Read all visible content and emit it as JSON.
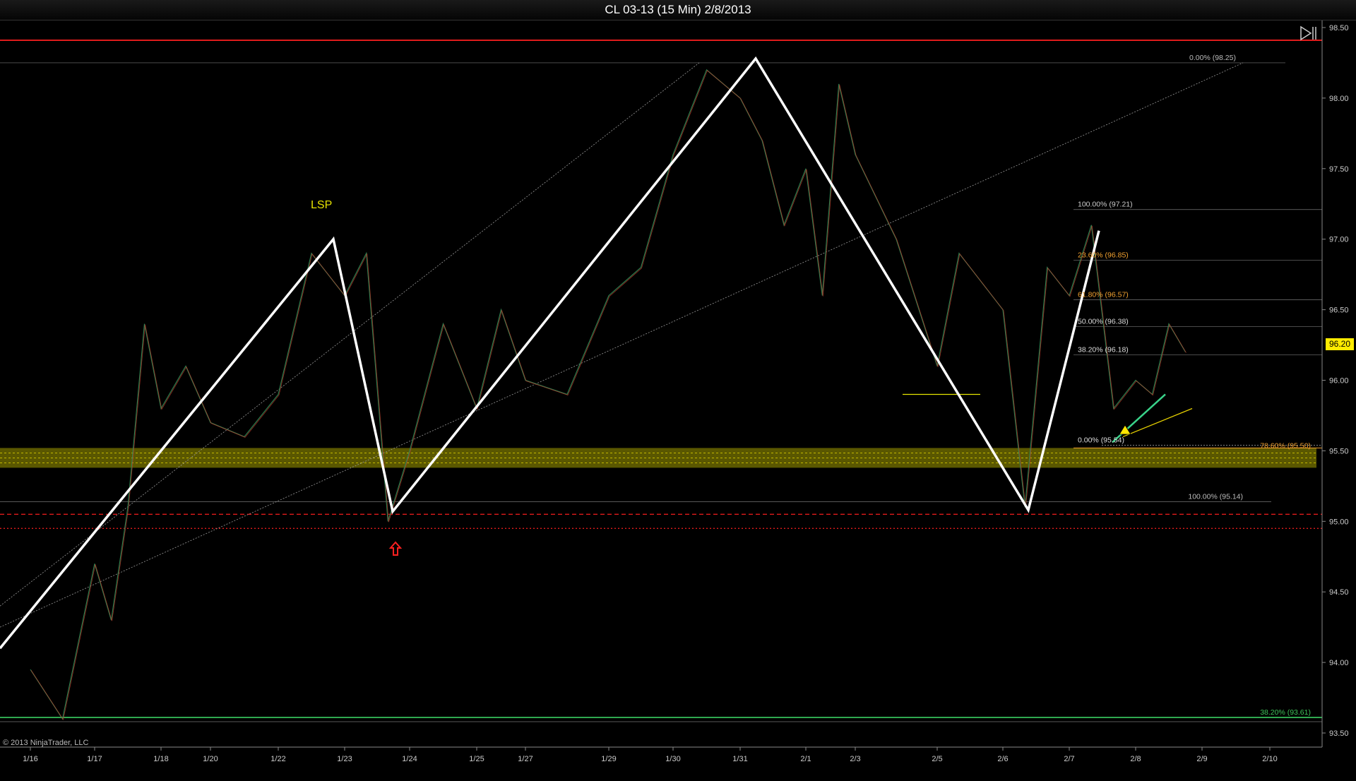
{
  "window": {
    "title": "CL 03-13 (15 Min)  2/8/2013"
  },
  "footer": {
    "copyright": "© 2013 NinjaTrader, LLC"
  },
  "last_price": "96.20",
  "icons": {
    "scroll": "scroll-end-icon",
    "marker": "red-up-arrow-icon",
    "alert": "warning-triangle-icon"
  },
  "colors": {
    "background": "#000000",
    "zigzag": "#ffffff",
    "resistance": "#e01b1b",
    "zone": "#c8c000",
    "fib_orange": "#f0a030",
    "green": "#39d38a",
    "price_badge": "#ffeb00"
  },
  "chart_data": {
    "type": "line",
    "title": "CL 03-13 (15 Min)  2/8/2013",
    "ylim": [
      93.4,
      98.55
    ],
    "y_ticks": [
      "98.50",
      "98.00",
      "97.50",
      "97.00",
      "96.50",
      "96.00",
      "95.50",
      "95.00",
      "94.50",
      "94.00",
      "93.50"
    ],
    "x_ticks": [
      "1/16",
      "1/17",
      "1/18",
      "1/20",
      "1/22",
      "1/23",
      "1/24",
      "1/25",
      "1/27",
      "1/29",
      "1/30",
      "1/31",
      "2/1",
      "2/3",
      "2/5",
      "2/6",
      "2/7",
      "2/8",
      "2/9",
      "2/10"
    ],
    "annotations": {
      "lsp": "LSP"
    },
    "zigzag": [
      {
        "date": "1/16",
        "price": 94.1
      },
      {
        "date": "1/22",
        "price": 97.0
      },
      {
        "date": "1/23",
        "price": 95.07
      },
      {
        "date": "1/31",
        "price": 98.28
      },
      {
        "date": "2/6",
        "price": 95.08
      },
      {
        "date": "2/7",
        "price": 97.06
      }
    ],
    "horizontal_levels": [
      {
        "price": 98.41,
        "color": "red",
        "style": "solid"
      },
      {
        "price": 95.05,
        "color": "red",
        "style": "dashed"
      },
      {
        "price": 94.95,
        "color": "red",
        "style": "dotted"
      },
      {
        "price": 93.61,
        "color": "green",
        "style": "solid"
      }
    ],
    "support_zone": {
      "low": 95.38,
      "high": 95.52
    },
    "fib_labels": [
      {
        "text": "0.00% (98.25)",
        "price": 98.25
      },
      {
        "text": "100.00% (97.21)",
        "price": 97.21
      },
      {
        "text": "23.60% (96.85)",
        "price": 96.85
      },
      {
        "text": "61.80% (96.57)",
        "price": 96.57
      },
      {
        "text": "50.00% (96.38)",
        "price": 96.38
      },
      {
        "text": "38.20% (96.18)",
        "price": 96.18
      },
      {
        "text": "0.00% (95.54)",
        "price": 95.54
      },
      {
        "text": "78.60% (95.50)",
        "price": 95.5
      },
      {
        "text": "100.00% (95.14)",
        "price": 95.14
      },
      {
        "text": "38.20% (93.61)",
        "price": 93.61
      }
    ],
    "price_path": [
      {
        "date": "1/16",
        "price": 93.95
      },
      {
        "date": "1/16",
        "price": 93.6
      },
      {
        "date": "1/17",
        "price": 94.7
      },
      {
        "date": "1/17",
        "price": 94.3
      },
      {
        "date": "1/17",
        "price": 95.1
      },
      {
        "date": "1/17",
        "price": 96.4
      },
      {
        "date": "1/18",
        "price": 95.8
      },
      {
        "date": "1/18",
        "price": 96.1
      },
      {
        "date": "1/20",
        "price": 95.7
      },
      {
        "date": "1/20",
        "price": 95.6
      },
      {
        "date": "1/22",
        "price": 95.9
      },
      {
        "date": "1/22",
        "price": 96.9
      },
      {
        "date": "1/23",
        "price": 96.6
      },
      {
        "date": "1/23",
        "price": 96.9
      },
      {
        "date": "1/23",
        "price": 95.0
      },
      {
        "date": "1/24",
        "price": 95.5
      },
      {
        "date": "1/24",
        "price": 96.4
      },
      {
        "date": "1/25",
        "price": 95.8
      },
      {
        "date": "1/25",
        "price": 96.5
      },
      {
        "date": "1/27",
        "price": 96.0
      },
      {
        "date": "1/27",
        "price": 95.9
      },
      {
        "date": "1/29",
        "price": 96.6
      },
      {
        "date": "1/29",
        "price": 96.8
      },
      {
        "date": "1/30",
        "price": 97.6
      },
      {
        "date": "1/30",
        "price": 98.2
      },
      {
        "date": "1/31",
        "price": 98.0
      },
      {
        "date": "1/31",
        "price": 97.7
      },
      {
        "date": "1/31",
        "price": 97.1
      },
      {
        "date": "2/1",
        "price": 97.5
      },
      {
        "date": "2/1",
        "price": 96.6
      },
      {
        "date": "2/1",
        "price": 98.1
      },
      {
        "date": "2/3",
        "price": 97.6
      },
      {
        "date": "2/3",
        "price": 97.0
      },
      {
        "date": "2/5",
        "price": 96.1
      },
      {
        "date": "2/5",
        "price": 96.9
      },
      {
        "date": "2/5",
        "price": 96.7
      },
      {
        "date": "2/6",
        "price": 96.5
      },
      {
        "date": "2/6",
        "price": 95.1
      },
      {
        "date": "2/6",
        "price": 96.8
      },
      {
        "date": "2/7",
        "price": 96.6
      },
      {
        "date": "2/7",
        "price": 97.1
      },
      {
        "date": "2/7",
        "price": 95.8
      },
      {
        "date": "2/8",
        "price": 96.0
      },
      {
        "date": "2/8",
        "price": 95.9
      },
      {
        "date": "2/8",
        "price": 96.4
      },
      {
        "date": "2/8",
        "price": 96.2
      }
    ]
  }
}
